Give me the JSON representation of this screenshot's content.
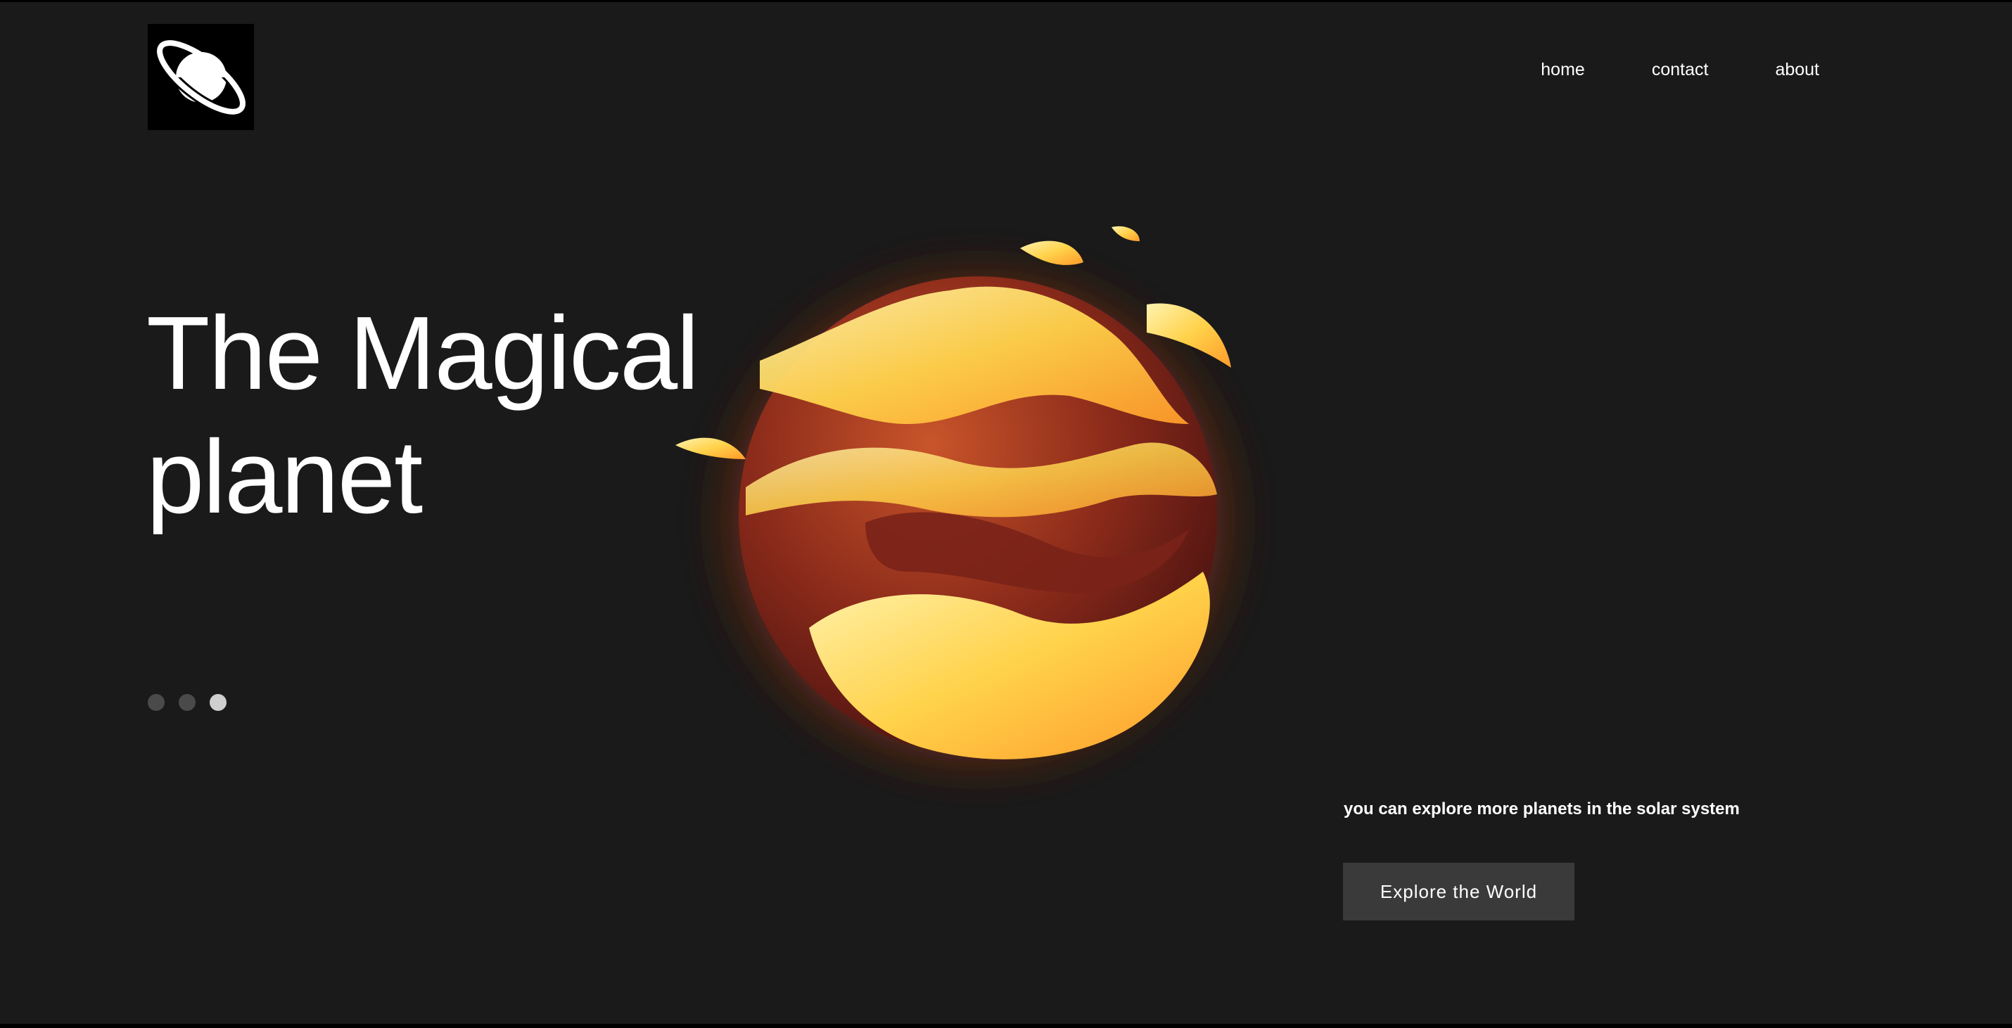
{
  "header": {
    "logo_icon": "planet-ring-icon",
    "nav": [
      {
        "label": "home"
      },
      {
        "label": "contact"
      },
      {
        "label": "about"
      }
    ]
  },
  "hero": {
    "title_line1": "The Magical",
    "title_line2": "planet",
    "slider": {
      "count": 3,
      "active_index": 2
    },
    "image_icon": "fire-planet-illustration"
  },
  "cta": {
    "tagline": "you can explore more planets in the solar system",
    "button_label": "Explore the World"
  },
  "colors": {
    "background": "#1a1a1a",
    "button": "#3a3a3a",
    "text": "#ffffff",
    "dot_inactive": "#4a4a4a",
    "dot_active": "#cfcfcf"
  }
}
